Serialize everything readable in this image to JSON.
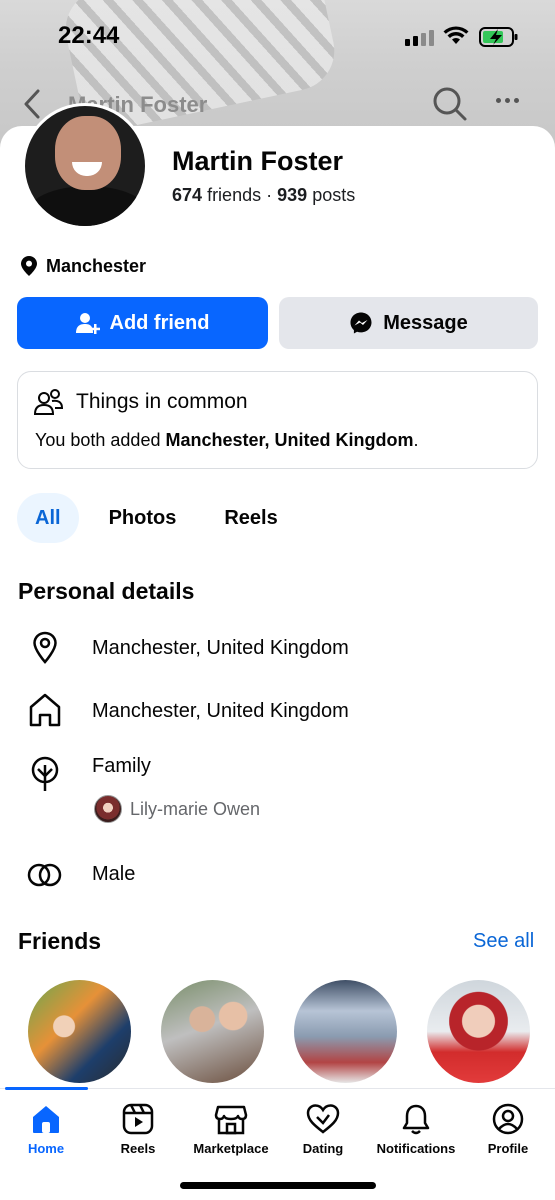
{
  "status": {
    "time": "22:44"
  },
  "topnav": {
    "title": "Martin Foster"
  },
  "profile": {
    "name": "Martin Foster",
    "friends_count": "674",
    "friends_label": "friends",
    "separator": "·",
    "posts_count": "939",
    "posts_label": "posts",
    "location": "Manchester"
  },
  "actions": {
    "add_friend": "Add friend",
    "message": "Message"
  },
  "common": {
    "title": "Things in common",
    "text_prefix": "You both added ",
    "text_bold": "Manchester, United Kingdom",
    "text_suffix": "."
  },
  "tabs": [
    {
      "label": "All",
      "active": true
    },
    {
      "label": "Photos",
      "active": false
    },
    {
      "label": "Reels",
      "active": false
    }
  ],
  "personal": {
    "title": "Personal details",
    "current_city": "Manchester, United Kingdom",
    "hometown": "Manchester, United Kingdom",
    "family_label": "Family",
    "family_member": "Lily-marie Owen",
    "gender": "Male"
  },
  "friends": {
    "title": "Friends",
    "see_all": "See all"
  },
  "bottom_nav": [
    {
      "label": "Home",
      "icon": "home-icon",
      "active": true
    },
    {
      "label": "Reels",
      "icon": "reels-icon",
      "active": false
    },
    {
      "label": "Marketplace",
      "icon": "marketplace-icon",
      "active": false
    },
    {
      "label": "Dating",
      "icon": "dating-icon",
      "active": false
    },
    {
      "label": "Notifications",
      "icon": "bell-icon",
      "active": false
    },
    {
      "label": "Profile",
      "icon": "profile-icon",
      "active": false
    }
  ],
  "colors": {
    "accent": "#0866ff",
    "link": "#0a66d6",
    "secondary_button": "#e4e6eb"
  }
}
